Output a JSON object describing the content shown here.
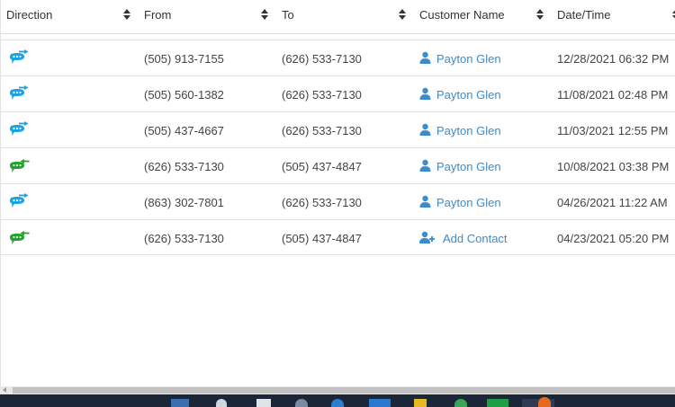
{
  "columns": {
    "direction": "Direction",
    "from": "From",
    "to": "To",
    "customer": "Customer Name",
    "datetime": "Date/Time"
  },
  "rows": [
    {
      "direction": "outbound",
      "from": "(505) 913-7155",
      "to": "(626) 533-7130",
      "customer": "Payton Glen",
      "contact_type": "person",
      "datetime": "12/28/2021 06:32 PM"
    },
    {
      "direction": "outbound",
      "from": "(505) 560-1382",
      "to": "(626) 533-7130",
      "customer": "Payton Glen",
      "contact_type": "person",
      "datetime": "11/08/2021 02:48 PM"
    },
    {
      "direction": "outbound",
      "from": "(505) 437-4667",
      "to": "(626) 533-7130",
      "customer": "Payton Glen",
      "contact_type": "person",
      "datetime": "11/03/2021 12:55 PM"
    },
    {
      "direction": "inbound",
      "from": "(626) 533-7130",
      "to": "(505) 437-4847",
      "customer": "Payton Glen",
      "contact_type": "person",
      "datetime": "10/08/2021 03:38 PM"
    },
    {
      "direction": "outbound",
      "from": "(863) 302-7801",
      "to": "(626) 533-7130",
      "customer": "Payton Glen",
      "contact_type": "person",
      "datetime": "04/26/2021 11:22 AM"
    },
    {
      "direction": "inbound",
      "from": "(626) 533-7130",
      "to": "(505) 437-4847",
      "customer": "Add Contact",
      "contact_type": "add",
      "datetime": "04/23/2021 05:20 PM"
    }
  ],
  "icons": {
    "outbound": "outbound-message-icon",
    "inbound": "inbound-message-icon",
    "person": "person-icon",
    "add": "add-contact-icon",
    "sort": "sort-icon"
  },
  "colors": {
    "outbound": "#1aa3e8",
    "inbound": "#1fa32a",
    "link": "#3a8ccc",
    "taskbar": "#1b2638"
  }
}
